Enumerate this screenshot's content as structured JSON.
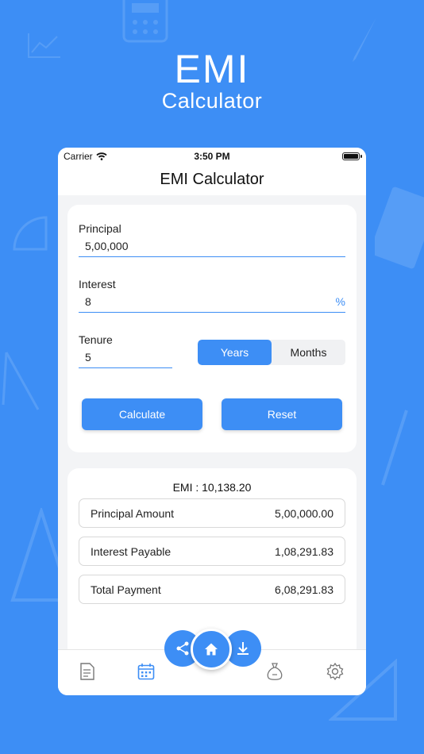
{
  "promo": {
    "title": "EMI",
    "subtitle": "Calculator"
  },
  "status_bar": {
    "carrier": "Carrier",
    "time": "3:50 PM"
  },
  "nav": {
    "title": "EMI Calculator"
  },
  "form": {
    "principal_label": "Principal",
    "principal_value": "5,00,000",
    "interest_label": "Interest",
    "interest_value": "8",
    "interest_unit": "%",
    "tenure_label": "Tenure",
    "tenure_value": "5",
    "tenure_units": [
      "Years",
      "Months"
    ],
    "tenure_unit_selected": "Years",
    "calculate_label": "Calculate",
    "reset_label": "Reset"
  },
  "results": {
    "emi_text": "EMI : 10,138.20",
    "rows": [
      {
        "label": "Principal Amount",
        "value": "5,00,000.00"
      },
      {
        "label": "Interest Payable",
        "value": "1,08,291.83"
      },
      {
        "label": "Total Payment",
        "value": "6,08,291.83"
      }
    ]
  },
  "tab_bar": {
    "items": [
      "gst-document-icon",
      "calendar-icon",
      "money-bag-icon",
      "settings-gear-icon"
    ],
    "fabs": [
      "share-icon",
      "home-icon",
      "download-icon"
    ],
    "accent": "#3d8ef5"
  },
  "colors": {
    "background": "#3d8ef5",
    "accent": "#3d8ef5",
    "card": "#ffffff",
    "screen": "#f3f4f6"
  }
}
